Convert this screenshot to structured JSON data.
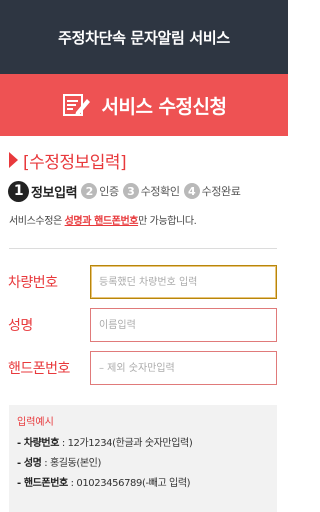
{
  "header": {
    "title": "주정차단속 문자알림 서비스"
  },
  "banner": {
    "title": "서비스 수정신청",
    "icon": "edit-document-icon"
  },
  "section": {
    "title": "[수정정보입력]"
  },
  "steps": [
    {
      "num": "1",
      "label": "정보입력",
      "active": true
    },
    {
      "num": "2",
      "label": "인증",
      "active": false
    },
    {
      "num": "3",
      "label": "수정확인",
      "active": false
    },
    {
      "num": "4",
      "label": "수정완료",
      "active": false
    }
  ],
  "notice": {
    "prefix": "서비스수정은 ",
    "highlight": "성명과 핸드폰번호",
    "suffix": "만 가능합니다."
  },
  "form": {
    "car": {
      "label": "차량번호",
      "placeholder": "등록했던 차량번호 입력",
      "value": ""
    },
    "name": {
      "label": "성명",
      "placeholder": "이름입력",
      "value": ""
    },
    "phone": {
      "label": "핸드폰번호",
      "placeholder": "– 제외 숫자만입력",
      "value": ""
    }
  },
  "example": {
    "title": "입력예시",
    "lines": [
      {
        "key": "- 차량번호",
        "value": " : 12가1234(한글과 숫자만입력)"
      },
      {
        "key": "- 성명",
        "value": " : 홍길동(본인)"
      },
      {
        "key": "- 핸드폰번호",
        "value": " : 01023456789(-빼고 입력)"
      }
    ]
  },
  "colors": {
    "header_bg": "#2e3642",
    "accent": "#ee5253",
    "label_red": "#e8393c"
  }
}
